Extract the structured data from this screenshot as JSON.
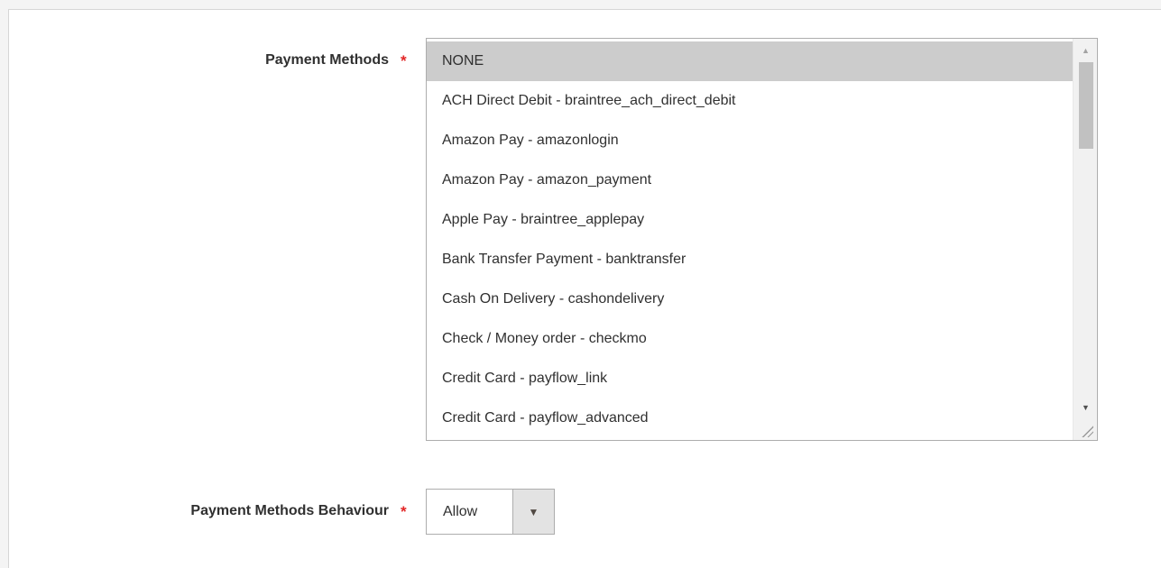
{
  "payment_methods": {
    "label": "Payment Methods",
    "required_mark": "*",
    "options": [
      "NONE",
      "ACH Direct Debit - braintree_ach_direct_debit",
      "Amazon Pay - amazonlogin",
      "Amazon Pay - amazon_payment",
      "Apple Pay - braintree_applepay",
      "Bank Transfer Payment - banktransfer",
      "Cash On Delivery - cashondelivery",
      "Check / Money order - checkmo",
      "Credit Card - payflow_link",
      "Credit Card - payflow_advanced"
    ],
    "selected_index": 0,
    "scroll_up_icon": "triangle-up-icon",
    "scroll_down_icon": "triangle-down-icon"
  },
  "payment_methods_behaviour": {
    "label": "Payment Methods Behaviour",
    "required_mark": "*",
    "value": "Allow",
    "toggle_icon": "caret-down-icon"
  },
  "colors": {
    "required": "#e22626",
    "selected_option_bg": "#cccccc",
    "border": "#adadad"
  }
}
